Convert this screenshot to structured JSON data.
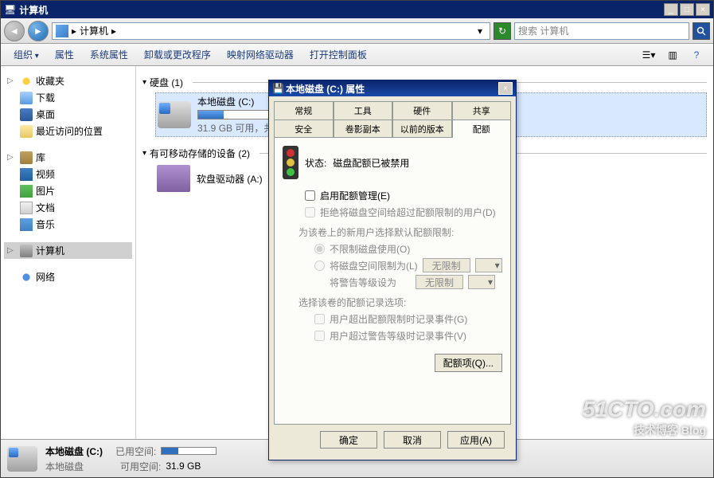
{
  "window": {
    "title": "计算机"
  },
  "nav": {
    "address": "计算机",
    "address_arrow": "▸",
    "search_placeholder": "搜索 计算机"
  },
  "menu": {
    "organize": "组织",
    "properties": "属性",
    "system_properties": "系统属性",
    "uninstall": "卸载或更改程序",
    "map_drive": "映射网络驱动器",
    "control_panel": "打开控制面板"
  },
  "sidebar": {
    "favorites": "收藏夹",
    "downloads": "下载",
    "desktop": "桌面",
    "recent": "最近访问的位置",
    "libraries": "库",
    "videos": "视频",
    "pictures": "图片",
    "documents": "文档",
    "music": "音乐",
    "computer": "计算机",
    "network": "网络"
  },
  "content": {
    "hdd_group": "硬盘 (1)",
    "removable_group": "有可移动存储的设备 (2)",
    "drive_c": {
      "name": "本地磁盘 (C:)",
      "free": "31.9 GB 可用，共"
    },
    "floppy": {
      "name": "软盘驱动器 (A:)"
    }
  },
  "statusbar": {
    "name": "本地磁盘 (C:)",
    "type": "本地磁盘",
    "used_label": "已用空间:",
    "free_label": "可用空间:",
    "free_value": "31.9 GB"
  },
  "dialog": {
    "title": "本地磁盘 (C:) 属性",
    "tabs_row1": [
      "常规",
      "工具",
      "硬件",
      "共享"
    ],
    "tabs_row2": [
      "安全",
      "卷影副本",
      "以前的版本",
      "配额"
    ],
    "active_tab": "配额",
    "status_label": "状态:",
    "status_value": "磁盘配额已被禁用",
    "enable_quota": "启用配额管理(E)",
    "deny_over": "拒绝将磁盘空间给超过配额限制的用户(D)",
    "default_label": "为该卷上的新用户选择默认配额限制:",
    "radio_unlimited": "不限制磁盘使用(O)",
    "radio_limit": "将磁盘空间限制为(L)",
    "warning_label": "将警告等级设为",
    "unlimited_value": "无限制",
    "log_label": "选择该卷的配额记录选项:",
    "log_exceed": "用户超出配额限制时记录事件(G)",
    "log_warning": "用户超过警告等级时记录事件(V)",
    "quota_entries": "配额项(Q)...",
    "ok": "确定",
    "cancel": "取消",
    "apply": "应用(A)"
  },
  "watermark": {
    "big": "51CTO.com",
    "small": "技术博客   Blog"
  }
}
